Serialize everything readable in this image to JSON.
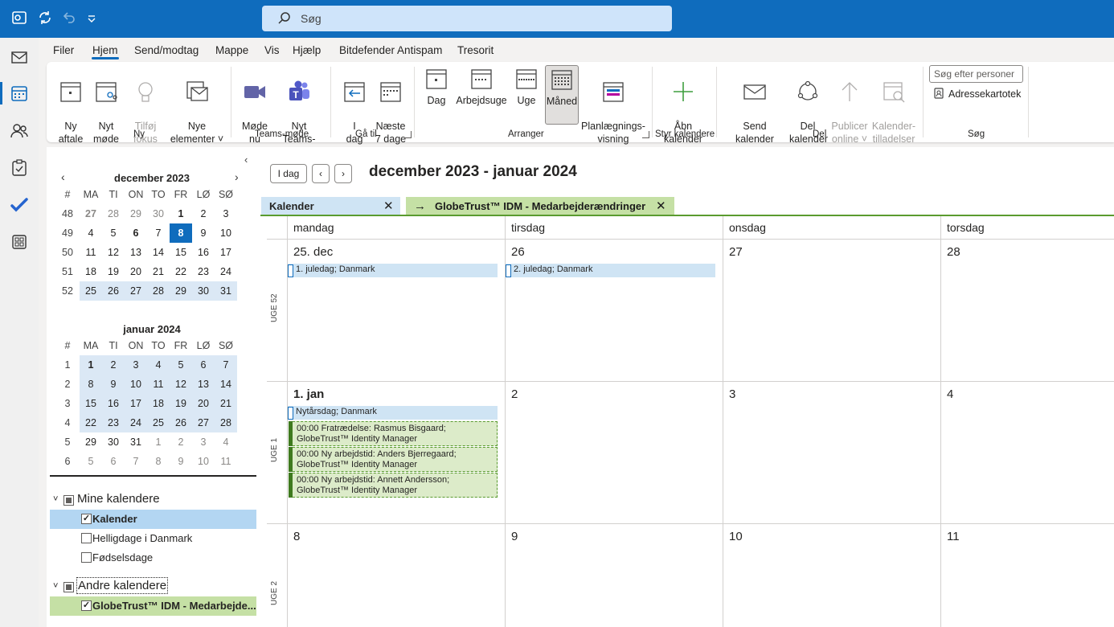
{
  "search": {
    "placeholder": "Søg"
  },
  "menu": [
    "Filer",
    "Hjem",
    "Send/modtag",
    "Mappe",
    "Vis",
    "Hjælp",
    "Bitdefender Antispam",
    "Tresorit"
  ],
  "ribbon": {
    "ny_aftale": "Ny\naftale",
    "nyt_mode": "Nyt\nmøde",
    "fokus": "Tilføj\nfokus Tid",
    "nye_elementer": "Nye\nelementer ˅",
    "group_ny": "Ny",
    "mode_nu": "Møde\nnu",
    "nyt_teams": "Nyt Teams-\nmøde",
    "group_teams": "Teams-møde",
    "i_dag": "I\ndag",
    "naeste7": "Næste\n7 dage",
    "group_gaa": "Gå til",
    "dag": "Dag",
    "arbejdsuge": "Arbejdsuge",
    "uge": "Uge",
    "maaned": "Måned",
    "planlaegning": "Planlægnings-\nvisning",
    "group_arranger": "Arranger",
    "aabn": "Åbn\nkalender ˅",
    "group_styr": "Styr kalendere",
    "send_kal": "Send kalender\nvia mail",
    "del_kal": "Del\nkalender",
    "publicer": "Publicer\nonline ˅",
    "tilladelser": "Kalender-\ntilladelser",
    "group_del": "Del",
    "person_search": "Søg efter personer",
    "adressekartotek": "Adressekartotek",
    "group_sog": "Søg"
  },
  "minical": {
    "dec_title": "december 2023",
    "jan_title": "januar 2024",
    "headers": [
      "#",
      "MA",
      "TI",
      "ON",
      "TO",
      "FR",
      "LØ",
      "SØ"
    ],
    "dec_rows": [
      [
        "48",
        "27",
        "28",
        "29",
        "30",
        "1",
        "2",
        "3"
      ],
      [
        "49",
        "4",
        "5",
        "6",
        "7",
        "8",
        "9",
        "10"
      ],
      [
        "50",
        "11",
        "12",
        "13",
        "14",
        "15",
        "16",
        "17"
      ],
      [
        "51",
        "18",
        "19",
        "20",
        "21",
        "22",
        "23",
        "24"
      ],
      [
        "52",
        "25",
        "26",
        "27",
        "28",
        "29",
        "30",
        "31"
      ]
    ],
    "jan_rows": [
      [
        "1",
        "1",
        "2",
        "3",
        "4",
        "5",
        "6",
        "7"
      ],
      [
        "2",
        "8",
        "9",
        "10",
        "11",
        "12",
        "13",
        "14"
      ],
      [
        "3",
        "15",
        "16",
        "17",
        "18",
        "19",
        "20",
        "21"
      ],
      [
        "4",
        "22",
        "23",
        "24",
        "25",
        "26",
        "27",
        "28"
      ],
      [
        "5",
        "29",
        "30",
        "31",
        "1",
        "2",
        "3",
        "4"
      ],
      [
        "6",
        "5",
        "6",
        "7",
        "8",
        "9",
        "10",
        "11"
      ]
    ]
  },
  "folders": {
    "mine": "Mine kalendere",
    "kalender": "Kalender",
    "helligdage": "Helligdage i Danmark",
    "fodselsdage": "Fødselsdage",
    "andre": "Andre kalendere",
    "globetrust": "GlobeTrust™ IDM - Medarbejde..."
  },
  "main": {
    "today_btn": "I dag",
    "range": "december 2023 - januar 2024",
    "tab1": "Kalender",
    "tab2": "GlobeTrust™ IDM - Medarbejderændringer",
    "days": [
      "mandag",
      "tirsdag",
      "onsdag",
      "torsdag"
    ],
    "weeks": [
      {
        "label": "UGE 52",
        "dates": [
          "25. dec",
          "26",
          "27",
          "28"
        ]
      },
      {
        "label": "UGE 1",
        "dates": [
          "1. jan",
          "2",
          "3",
          "4"
        ]
      },
      {
        "label": "UGE 2",
        "dates": [
          "8",
          "9",
          "10",
          "11"
        ]
      }
    ],
    "events": {
      "juledag1": "1. juledag; Danmark",
      "juledag2": "2. juledag; Danmark",
      "nytaar": "Nytårsdag; Danmark",
      "g1_l1": "00:00 Fratrædelse: Rasmus Bisgaard;",
      "g1_l2": "GlobeTrust™ Identity Manager",
      "g2_l1": "00:00 Ny arbejdstid: Anders Bjerregaard;",
      "g2_l2": "GlobeTrust™ Identity Manager",
      "g3_l1": "00:00 Ny arbejdstid: Annett Andersson;",
      "g3_l2": "GlobeTrust™ Identity Manager"
    }
  },
  "colors": {
    "accent": "#0f6cbd",
    "green": "#5a9b2f",
    "selected_folder": "#b3d6f2",
    "other_folder": "#c5e0a5"
  }
}
